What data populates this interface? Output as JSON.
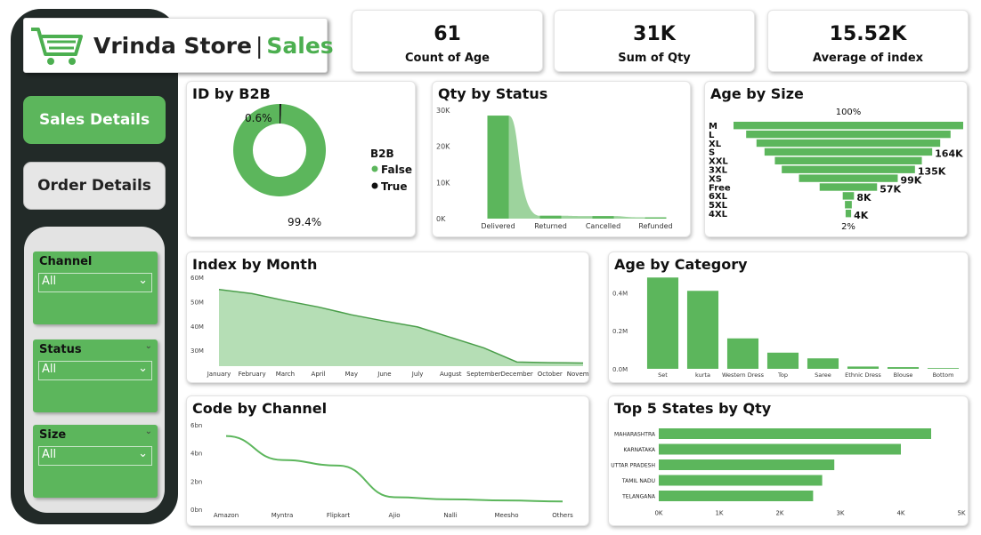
{
  "brand": {
    "name": "Vrinda Store",
    "separator": "|",
    "section": "Sales"
  },
  "nav": {
    "sales_details": "Sales Details",
    "order_details": "Order Details"
  },
  "filters": [
    {
      "label": "Channel",
      "value": "All"
    },
    {
      "label": "Status",
      "value": "All"
    },
    {
      "label": "Size",
      "value": "All"
    }
  ],
  "kpis": [
    {
      "value": "61",
      "label": "Count of Age"
    },
    {
      "value": "31K",
      "label": "Sum of Qty"
    },
    {
      "value": "15.52K",
      "label": "Average of index"
    }
  ],
  "colors": {
    "accent": "#5cb65c",
    "dark_panel": "#222a28",
    "true_slice": "#111111"
  },
  "chart_data": [
    {
      "id": "id_by_b2b",
      "type": "pie",
      "title": "ID by B2B",
      "legend_title": "B2B",
      "legend_position": "right",
      "slices": [
        {
          "name": "False",
          "value": 99.4,
          "label": "99.4%"
        },
        {
          "name": "True",
          "value": 0.6,
          "label": "0.6%"
        }
      ]
    },
    {
      "id": "qty_by_status",
      "type": "area",
      "title": "Qty by Status",
      "categories": [
        "Delivered",
        "Returned",
        "Cancelled",
        "Refunded"
      ],
      "values": [
        28500,
        800,
        700,
        350
      ],
      "yticks": [
        "30K",
        "20K",
        "10K",
        "0K"
      ],
      "ylim": [
        0,
        30000
      ]
    },
    {
      "id": "age_by_size",
      "type": "bar",
      "title": "Age by Size",
      "subtype": "funnel",
      "top_label": "100%",
      "categories": [
        "M",
        "L",
        "XL",
        "S",
        "XXL",
        "3XL",
        "XS",
        "Free",
        "6XL",
        "5XL",
        "4XL"
      ],
      "values": [
        100,
        89,
        80,
        73,
        64,
        58,
        43,
        25,
        4.9,
        3,
        2.4
      ],
      "data_labels": [
        "",
        "",
        "",
        "164K",
        "",
        "135K",
        "99K",
        "57K",
        "8K",
        "",
        "4K"
      ],
      "bottom_label": "2%"
    },
    {
      "id": "index_by_month",
      "type": "area",
      "title": "Index by Month",
      "categories": [
        "January",
        "February",
        "March",
        "April",
        "May",
        "June",
        "July",
        "August",
        "September",
        "December",
        "October",
        "November"
      ],
      "values": [
        55,
        53.3,
        50.4,
        47.8,
        44.6,
        42,
        39.6,
        35.3,
        31,
        25.2,
        24.9,
        24.8
      ],
      "yticks": [
        "60M",
        "50M",
        "40M",
        "30M"
      ],
      "ylim": [
        23.5,
        60
      ]
    },
    {
      "id": "age_by_category",
      "type": "bar",
      "title": "Age by Category",
      "categories": [
        "Set",
        "kurta",
        "Western Dress",
        "Top",
        "Saree",
        "Ethnic Dress",
        "Blouse",
        "Bottom"
      ],
      "values": [
        0.48,
        0.41,
        0.16,
        0.085,
        0.055,
        0.012,
        0.009,
        0.004
      ],
      "yticks": [
        "0.4M",
        "0.2M",
        "0.0M"
      ],
      "ylim": [
        0,
        0.5
      ]
    },
    {
      "id": "code_by_channel",
      "type": "line",
      "title": "Code by Channel",
      "categories": [
        "Amazon",
        "Myntra",
        "Flipkart",
        "Ajio",
        "Nalli",
        "Meesho",
        "Others"
      ],
      "values": [
        5.2,
        3.5,
        3.1,
        0.85,
        0.7,
        0.62,
        0.55
      ],
      "yticks": [
        "6bn",
        "4bn",
        "2bn",
        "0bn"
      ],
      "ylim": [
        0,
        6
      ]
    },
    {
      "id": "top5_states_by_qty",
      "type": "bar",
      "title": "Top 5 States by Qty",
      "orientation": "horizontal",
      "categories": [
        "MAHARASHTRA",
        "KARNATAKA",
        "UTTAR PRADESH",
        "TAMIL NADU",
        "TELANGANA"
      ],
      "values": [
        4500,
        4000,
        2900,
        2700,
        2550
      ],
      "xticks": [
        "0K",
        "1K",
        "2K",
        "3K",
        "4K",
        "5K"
      ],
      "xlim": [
        0,
        5000
      ]
    }
  ]
}
